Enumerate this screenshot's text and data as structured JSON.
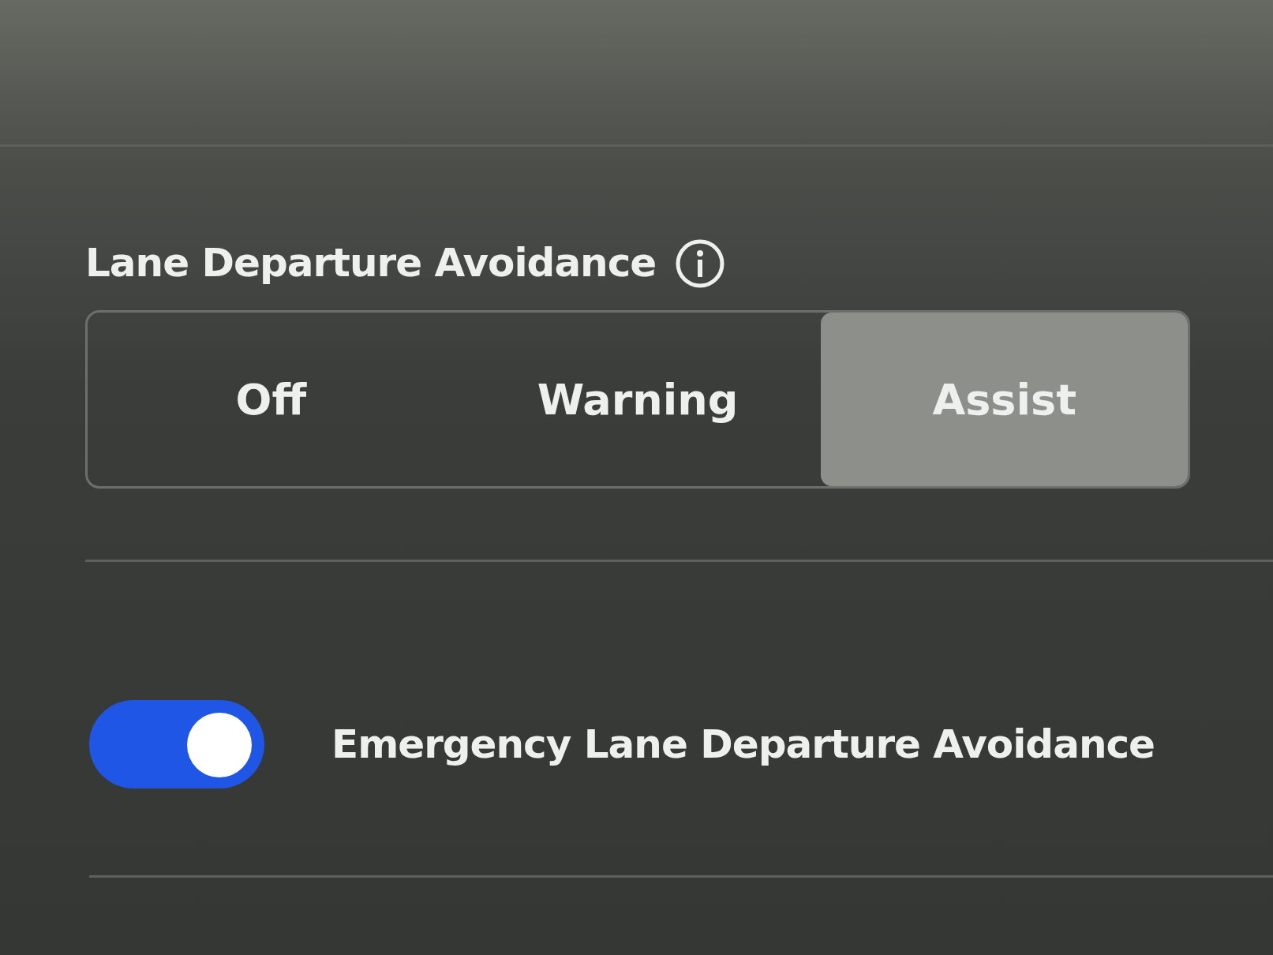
{
  "lane_departure": {
    "title": "Lane Departure Avoidance",
    "options": [
      {
        "label": "Off",
        "selected": false
      },
      {
        "label": "Warning",
        "selected": false
      },
      {
        "label": "Assist",
        "selected": true
      }
    ]
  },
  "emergency": {
    "label": "Emergency Lane Departure Avoidance",
    "on": true
  }
}
